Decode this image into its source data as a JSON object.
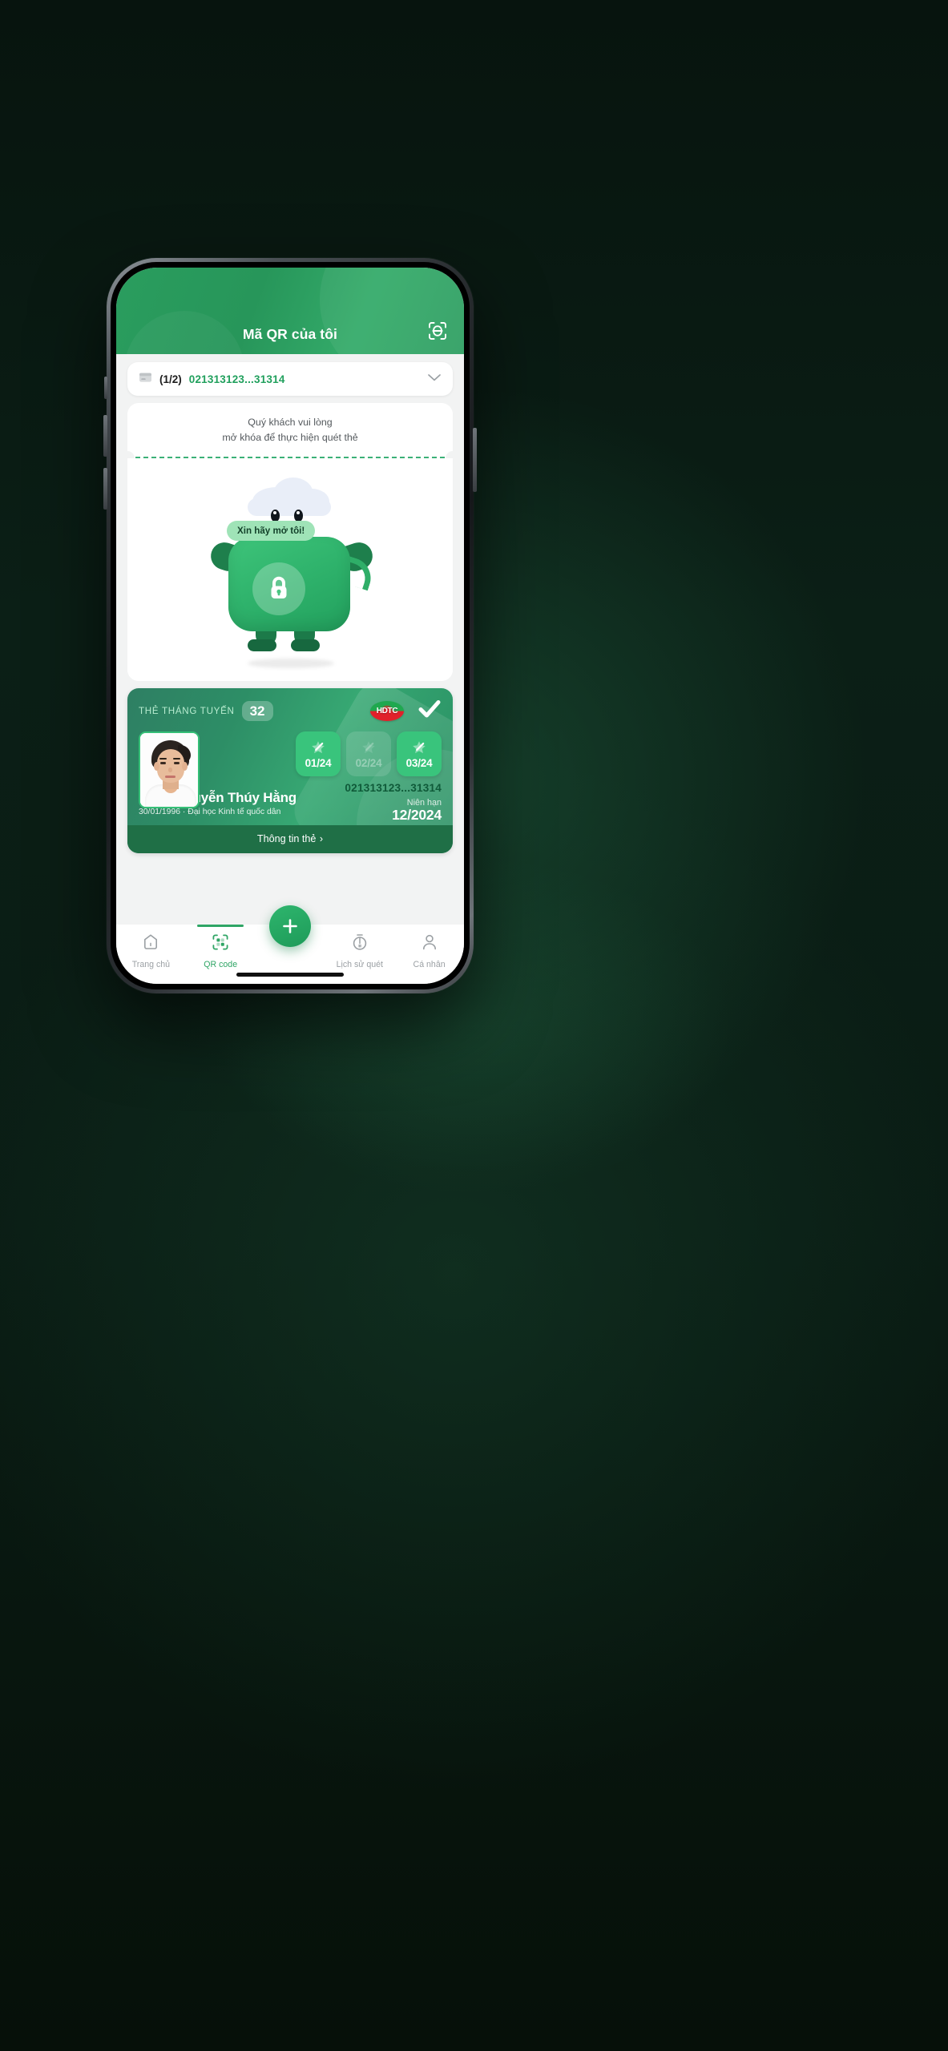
{
  "header": {
    "title": "Mã QR của tôi",
    "scan_icon": "scan-qr-icon"
  },
  "card_selector": {
    "card_icon": "card-icon",
    "count": "(1/2)",
    "number": "021313123...31314",
    "chevron_icon": "chevron-down-icon"
  },
  "notice": {
    "line1": "Quý khách vui lòng",
    "line2": "mở khóa để thực hiện quét thẻ"
  },
  "mascot": {
    "bubble": "Xin hãy mở tôi!",
    "lock_icon": "lock-icon",
    "cloud_icon": "crying-cloud-icon"
  },
  "student_card": {
    "type_label": "THẺ THÁNG TUYẾN",
    "route_number": "32",
    "brand_logo_text": "HDTC",
    "verified_icon": "check-icon",
    "avatar": "student-photo",
    "months": [
      {
        "label": "01/24",
        "active": true
      },
      {
        "label": "02/24",
        "active": false
      },
      {
        "label": "03/24",
        "active": true
      }
    ],
    "card_number": "021313123...31314",
    "expiry_label": "Niên hạn",
    "expiry_value": "12/2024",
    "name": "Phan Nguyễn Thúy Hằng",
    "meta": "30/01/1996 · Đại học Kinh tế quốc dân",
    "footer_label": "Thông tin thẻ",
    "footer_chevron": "›"
  },
  "tabbar": {
    "items": [
      {
        "label": "Trang chủ",
        "icon": "home-icon",
        "active": false
      },
      {
        "label": "QR code",
        "icon": "qr-code-icon",
        "active": true
      },
      {
        "label": "Lịch sử quét",
        "icon": "history-icon",
        "active": false
      },
      {
        "label": "Cá nhân",
        "icon": "person-icon",
        "active": false
      }
    ],
    "fab_icon": "plus-icon"
  },
  "colors": {
    "brand_green": "#2a9d5e",
    "accent_green": "#39c47c",
    "dark_green": "#1f6f46",
    "muted_gray": "#9ba0a4"
  }
}
